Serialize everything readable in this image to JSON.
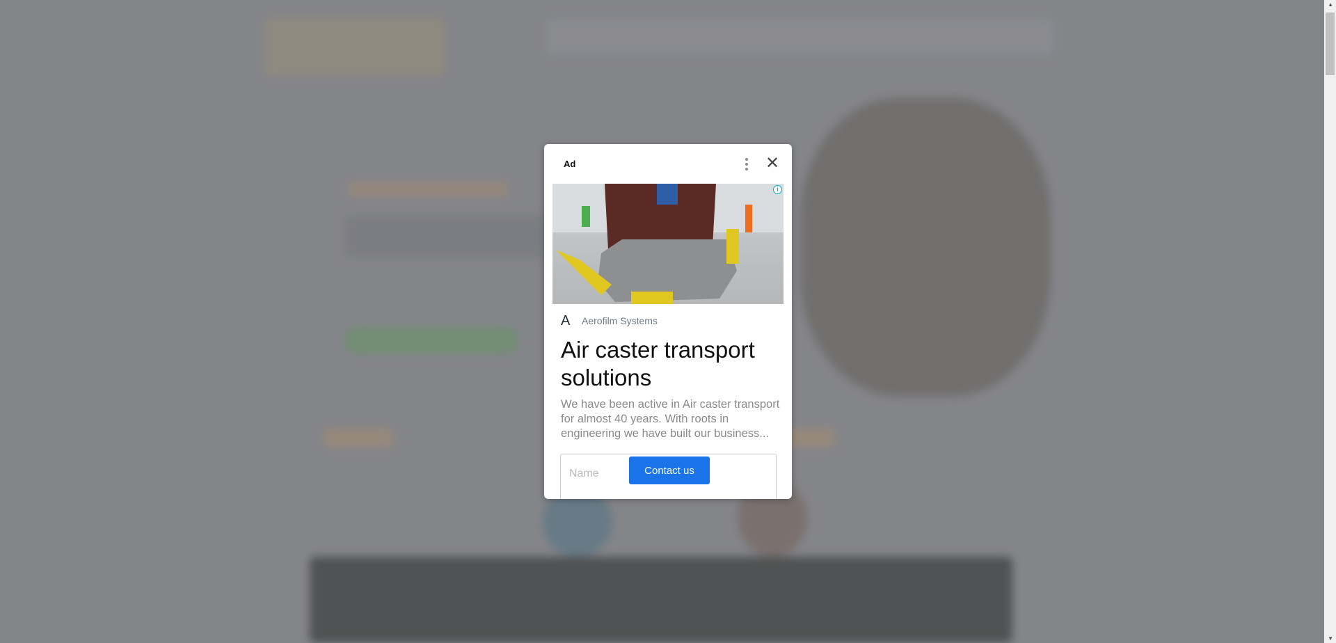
{
  "ad": {
    "label": "Ad",
    "more_icon": "more-vert-icon",
    "close_icon": "close-icon",
    "info_icon": "info-icon",
    "brand_logo": "A",
    "brand_name": "Aerofilm Systems",
    "headline": "Air caster transport solutions",
    "description": "We have been active in Air caster transport for almost 40 years. With roots in engineering we have built our business...",
    "form": {
      "name_placeholder": "Name",
      "submit_label": "Contact us"
    },
    "colors": {
      "button": "#1a73e8",
      "info": "#00aecd"
    }
  }
}
